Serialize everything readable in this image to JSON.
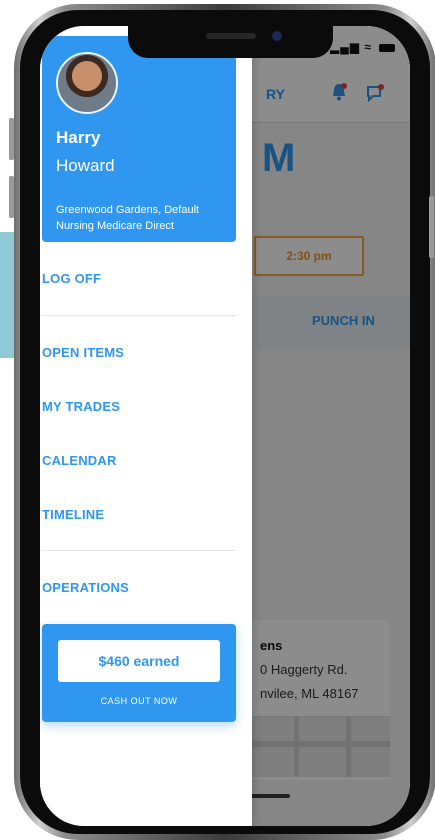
{
  "colors": {
    "accent": "#2f97ef",
    "highlight_orange": "#f0a63b",
    "teal_band": "#8fcad6"
  },
  "status_bar": {
    "signal": "▂▄▆"
  },
  "background_app": {
    "nav_partial": "RY",
    "big_time_partial": "M",
    "time_value": "2:30 pm",
    "punch_in_label": "PUNCH IN",
    "location": {
      "name_partial": "ens",
      "address_line1_partial": "0 Haggerty Rd.",
      "address_line2_partial": "nvilee, ML 48167"
    },
    "icons": [
      "bell-icon",
      "chat-icon"
    ]
  },
  "drawer": {
    "profile": {
      "first_name": "Harry",
      "last_name": "Howard",
      "facility": "Greenwood Gardens, Default Nursing Medicare Direct"
    },
    "menu": {
      "log_off": "LOG OFF",
      "open_items": "OPEN ITEMS",
      "my_trades": "MY TRADES",
      "calendar": "CALENDAR",
      "timeline": "TIMELINE",
      "operations": "OPERATIONS"
    },
    "earnings": {
      "earned_label": "$460 earned",
      "cash_out_label": "CASH OUT NOW"
    }
  }
}
